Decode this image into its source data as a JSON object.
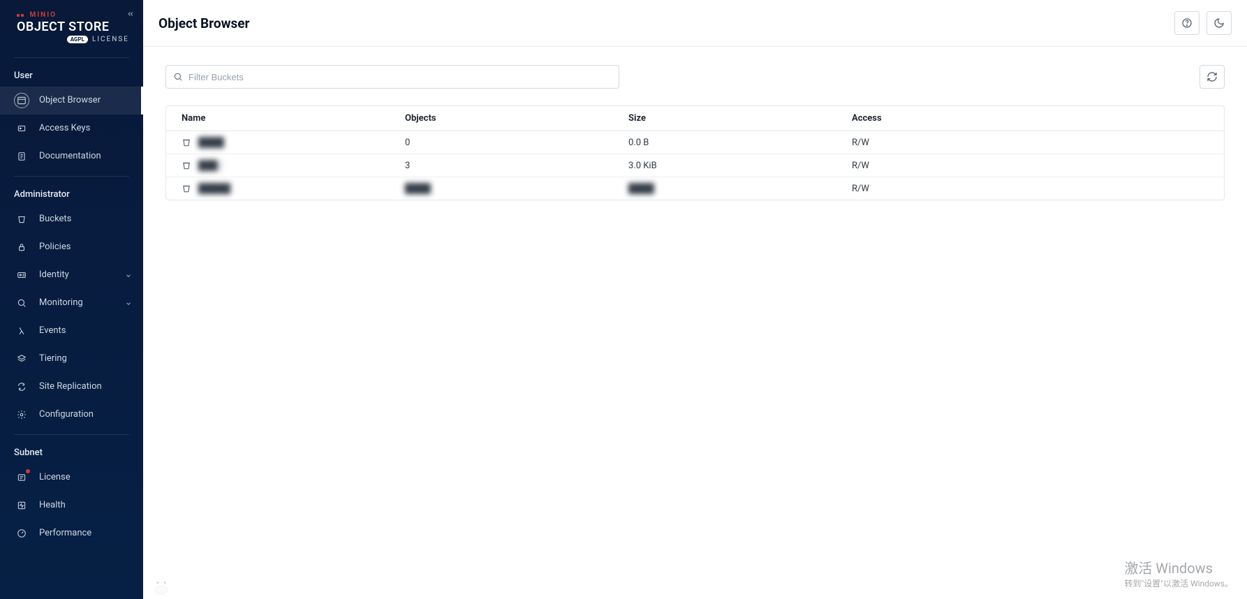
{
  "logo": {
    "brand": "MINIO",
    "product": "OBJECT STORE",
    "badge": "AGPL",
    "license_word": "LICENSE"
  },
  "sidebar": {
    "sections": [
      {
        "title": "User",
        "items": [
          {
            "id": "object-browser",
            "label": "Object Browser",
            "icon": "browser",
            "active": true
          },
          {
            "id": "access-keys",
            "label": "Access Keys",
            "icon": "keys"
          },
          {
            "id": "documentation",
            "label": "Documentation",
            "icon": "doc"
          }
        ]
      },
      {
        "title": "Administrator",
        "items": [
          {
            "id": "buckets",
            "label": "Buckets",
            "icon": "bucket"
          },
          {
            "id": "policies",
            "label": "Policies",
            "icon": "lock"
          },
          {
            "id": "identity",
            "label": "Identity",
            "icon": "id",
            "expandable": true
          },
          {
            "id": "monitoring",
            "label": "Monitoring",
            "icon": "search",
            "expandable": true
          },
          {
            "id": "events",
            "label": "Events",
            "icon": "lambda"
          },
          {
            "id": "tiering",
            "label": "Tiering",
            "icon": "layers"
          },
          {
            "id": "site-replication",
            "label": "Site Replication",
            "icon": "sync"
          },
          {
            "id": "configuration",
            "label": "Configuration",
            "icon": "gear"
          }
        ]
      },
      {
        "title": "Subnet",
        "items": [
          {
            "id": "license",
            "label": "License",
            "icon": "license",
            "badge": true
          },
          {
            "id": "health",
            "label": "Health",
            "icon": "health"
          },
          {
            "id": "performance",
            "label": "Performance",
            "icon": "perf"
          }
        ]
      }
    ]
  },
  "header": {
    "title": "Object Browser"
  },
  "search": {
    "placeholder": "Filter Buckets"
  },
  "table": {
    "columns": [
      "Name",
      "Objects",
      "Size",
      "Access"
    ],
    "rows": [
      {
        "name": "████",
        "name_blur": true,
        "objects": "0",
        "size": "0.0 B",
        "access": "R/W"
      },
      {
        "name": "███",
        "name_blur": true,
        "objects": "3",
        "size": "3.0 KiB",
        "access": "R/W"
      },
      {
        "name": "█████",
        "name_blur": true,
        "objects": "████",
        "objects_blur": true,
        "size": "████",
        "size_blur": true,
        "access": "R/W"
      }
    ]
  },
  "watermark": {
    "line1": "激活 Windows",
    "line2": "转到\"设置\"以激活 Windows。"
  }
}
